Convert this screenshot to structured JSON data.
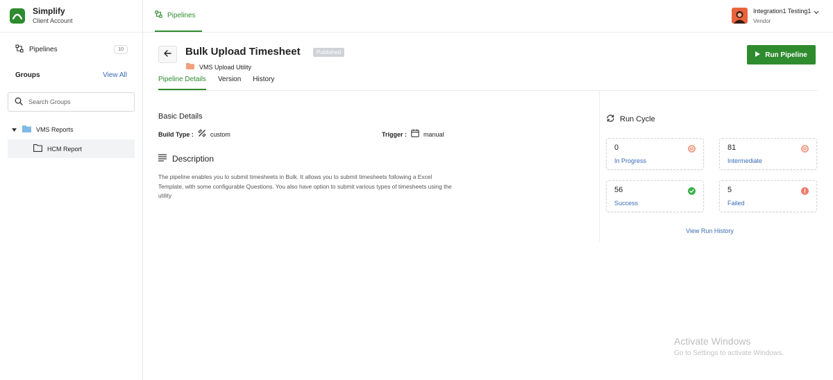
{
  "app": {
    "name": "Simplify",
    "subtitle": "Client Account",
    "brand_color": "#2e8b2e"
  },
  "sidebar": {
    "pipelines_label": "Pipelines",
    "pipelines_count": "10",
    "groups_title": "Groups",
    "view_all": "View All",
    "search_placeholder": "Search Groups",
    "tree": [
      {
        "label": "VMS Reports",
        "expanded": true,
        "icon": "folder-filled-icon"
      },
      {
        "label": "HCM Report",
        "selected": true,
        "icon": "folder-outline-icon"
      }
    ]
  },
  "topbar": {
    "active_tab": "Pipelines",
    "user": {
      "name": "Integration1 Testing1",
      "role": "Vendor"
    }
  },
  "header": {
    "title": "Bulk Upload Timesheet",
    "status": "Published",
    "utility": "VMS Upload Utility",
    "run_button": "Run Pipeline"
  },
  "tabs": [
    {
      "label": "Pipeline Details",
      "active": true
    },
    {
      "label": "Version",
      "active": false
    },
    {
      "label": "History",
      "active": false
    }
  ],
  "details": {
    "section_title": "Basic Details",
    "build_type_label": "Build Type :",
    "build_type_value": "custom",
    "trigger_label": "Trigger :",
    "trigger_value": "manual",
    "description_title": "Description",
    "description_text": "The pipeline enables you to submit timesheets in Bulk. It allows you to submit timesheets following a Excel Template, with some configurable Questions. You also have option to submit various types of timesheets using the utility"
  },
  "run_cycle": {
    "title": "Run Cycle",
    "stats": [
      {
        "value": "0",
        "label": "In Progress",
        "color": "#f0a08a",
        "icon": "clock-icon"
      },
      {
        "value": "81",
        "label": "Intermediate",
        "color": "#f0a08a",
        "icon": "clock-icon"
      },
      {
        "value": "56",
        "label": "Success",
        "color": "#3cb04a",
        "icon": "check-circle-icon"
      },
      {
        "value": "5",
        "label": "Failed",
        "color": "#ef7b6c",
        "icon": "alert-circle-icon"
      }
    ],
    "view_history": "View Run History"
  },
  "watermark": {
    "title": "Activate Windows",
    "subtitle": "Go to Settings to activate Windows."
  }
}
